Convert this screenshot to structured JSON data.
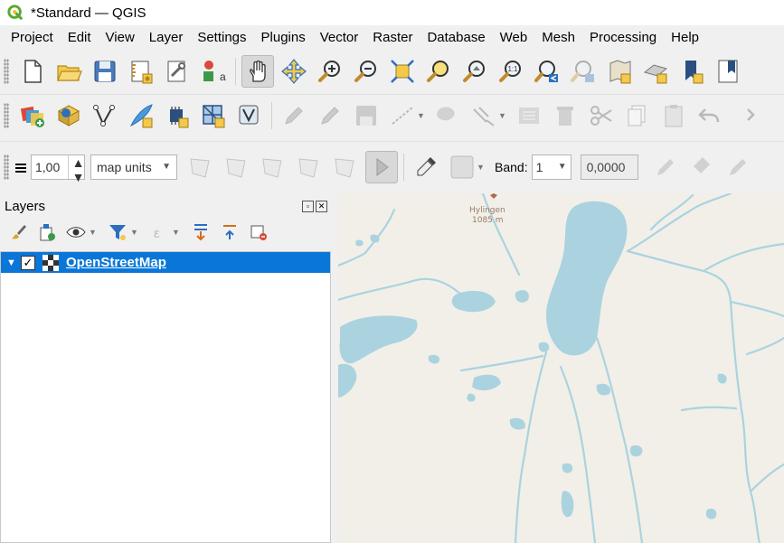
{
  "window": {
    "title": "*Standard — QGIS",
    "logo_icon": "qgis-logo-icon"
  },
  "menubar": {
    "items": [
      "Project",
      "Edit",
      "View",
      "Layer",
      "Settings",
      "Plugins",
      "Vector",
      "Raster",
      "Database",
      "Web",
      "Mesh",
      "Processing",
      "Help"
    ]
  },
  "toolbar_digitize": {
    "stroke_width": "1,00",
    "unit": "map units",
    "band_label": "Band:",
    "band_value": "1",
    "value": "0,0000"
  },
  "layers_panel": {
    "title": "Layers",
    "layer_name": "OpenStreetMap",
    "layer_checked": true
  },
  "map": {
    "peak_name": "Hylingen",
    "peak_elevation": "1085 m",
    "water_color": "#aad3df",
    "land_color": "#f2efe9"
  },
  "colors": {
    "selection": "#0a77d8",
    "accent": "#1c9a2e"
  }
}
